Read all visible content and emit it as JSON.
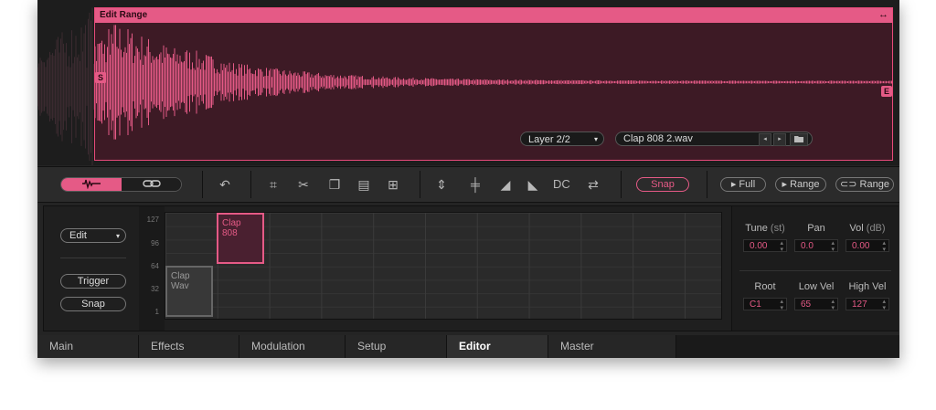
{
  "colors": {
    "accent": "#e55a86",
    "background": "#242424",
    "range_fill": "#3d1a25"
  },
  "edit_range": {
    "title": "Edit Range",
    "resize_icon": "↔",
    "start_marker": "S",
    "end_marker": "E"
  },
  "layer": {
    "label": "Layer 2/2",
    "caret": "▾"
  },
  "file": {
    "name": "Clap 808 2.wav",
    "prev": "◂",
    "next": "▸",
    "folder_icon": "folder-icon"
  },
  "toolbar": {
    "view_wave_icon": "waveform-icon",
    "view_link_icon": "link-icon",
    "dc_label": "DC",
    "snap_label": "Snap",
    "play_full": "▸ Full",
    "play_range": "▸ Range",
    "loop_range": "⊂⊃ Range"
  },
  "left_panel": {
    "edit_label": "Edit",
    "edit_caret": "▾",
    "trigger_label": "Trigger",
    "snap_label": "Snap"
  },
  "axis_labels": [
    "127",
    "96",
    "64",
    "32",
    "1"
  ],
  "zones": [
    {
      "label": "Clap 808",
      "selected": true
    },
    {
      "label": "Clap Wav",
      "selected": false
    }
  ],
  "params": {
    "tune_label": "Tune",
    "tune_unit": "(st)",
    "tune_value": "0.00",
    "pan_label": "Pan",
    "pan_value": "0.0",
    "vol_label": "Vol",
    "vol_unit": "(dB)",
    "vol_value": "0.00",
    "root_label": "Root",
    "root_value": "C1",
    "lowvel_label": "Low Vel",
    "lowvel_value": "65",
    "highvel_label": "High Vel",
    "highvel_value": "127",
    "spin": "⌃⌄"
  },
  "tabs": [
    {
      "label": "Main"
    },
    {
      "label": "Effects"
    },
    {
      "label": "Modulation"
    },
    {
      "label": "Setup"
    },
    {
      "label": "Editor"
    },
    {
      "label": "Master"
    }
  ]
}
